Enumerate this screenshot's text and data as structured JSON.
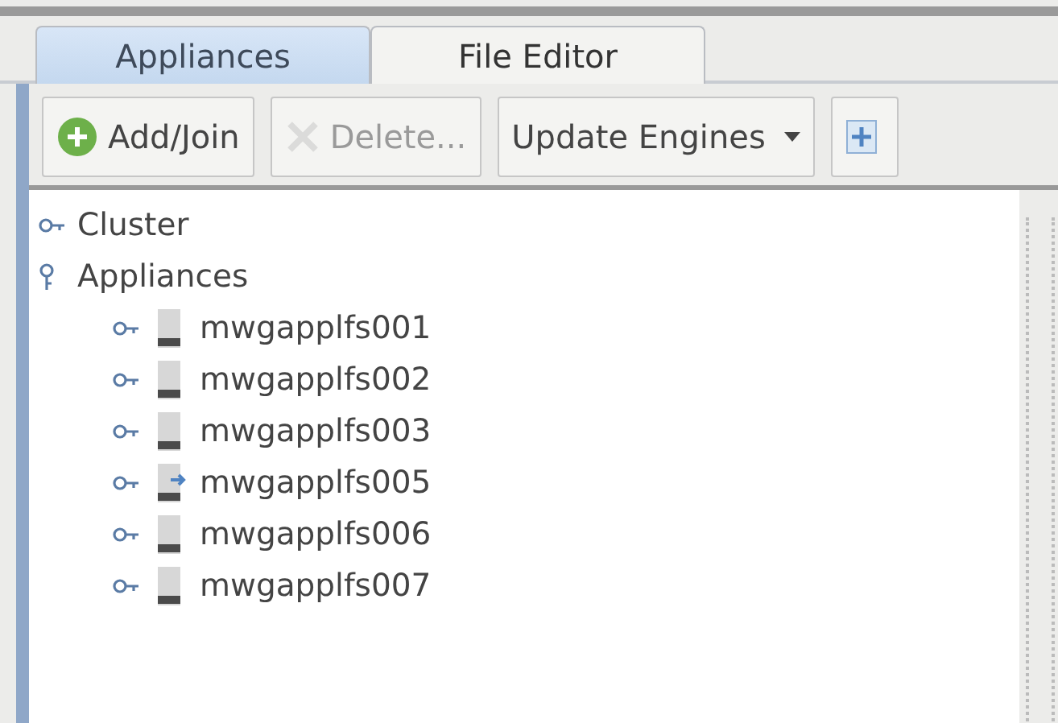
{
  "tabs": [
    {
      "label": "Appliances",
      "selected": true
    },
    {
      "label": "File Editor",
      "selected": false
    }
  ],
  "toolbar": [
    {
      "kind": "add",
      "label": "Add/Join",
      "disabled": false
    },
    {
      "kind": "delete",
      "label": "Delete...",
      "disabled": true
    },
    {
      "kind": "dropdown",
      "label": "Update Engines",
      "disabled": false
    },
    {
      "kind": "plus",
      "disabled": false
    }
  ],
  "tree": [
    {
      "label": "Cluster",
      "expanded": false
    },
    {
      "label": "Appliances",
      "expanded": true,
      "children": [
        {
          "label": "mwgapplfs001",
          "expanded": false,
          "overlay": false
        },
        {
          "label": "mwgapplfs002",
          "expanded": false,
          "overlay": false
        },
        {
          "label": "mwgapplfs003",
          "expanded": false,
          "overlay": false
        },
        {
          "label": "mwgapplfs005",
          "expanded": false,
          "overlay": true
        },
        {
          "label": "mwgapplfs006",
          "expanded": false,
          "overlay": false
        },
        {
          "label": "mwgapplfs007",
          "expanded": false,
          "overlay": false
        }
      ]
    }
  ]
}
